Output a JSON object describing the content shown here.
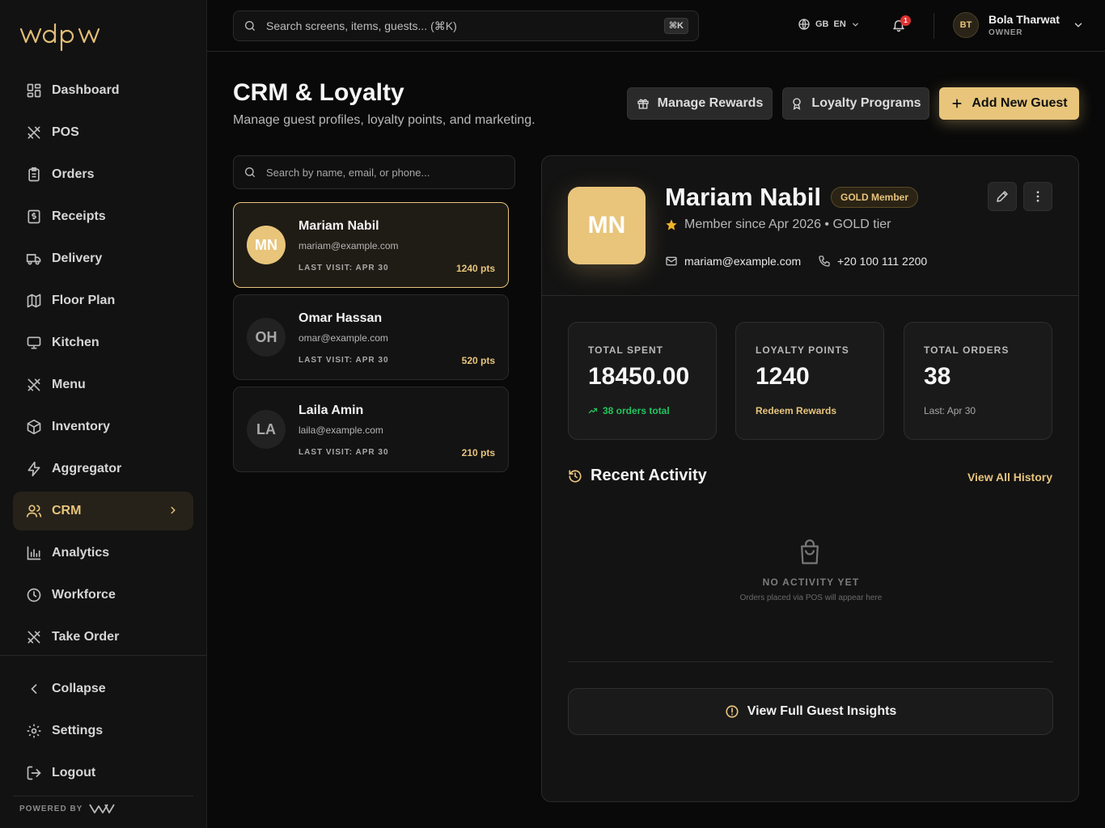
{
  "brand": {
    "logo_text": "wdpw",
    "powered_by": "POWERED BY"
  },
  "sidebar": {
    "items": [
      {
        "label": "Dashboard",
        "icon": "dashboard-icon"
      },
      {
        "label": "POS",
        "icon": "utensils-icon"
      },
      {
        "label": "Orders",
        "icon": "clipboard-icon"
      },
      {
        "label": "Receipts",
        "icon": "receipt-icon"
      },
      {
        "label": "Delivery",
        "icon": "truck-icon"
      },
      {
        "label": "Floor Plan",
        "icon": "map-icon"
      },
      {
        "label": "Kitchen",
        "icon": "monitor-icon"
      },
      {
        "label": "Menu",
        "icon": "utensils-icon"
      },
      {
        "label": "Inventory",
        "icon": "box-icon"
      },
      {
        "label": "Aggregator",
        "icon": "bolt-icon"
      },
      {
        "label": "CRM",
        "icon": "users-icon",
        "active": true
      },
      {
        "label": "Analytics",
        "icon": "bar-chart-icon"
      },
      {
        "label": "Workforce",
        "icon": "clock-icon"
      },
      {
        "label": "Take Order",
        "icon": "utensils-icon"
      }
    ],
    "bottom": {
      "collapse": "Collapse",
      "settings": "Settings",
      "logout": "Logout"
    }
  },
  "topbar": {
    "search_placeholder": "Search screens, items, guests... (⌘K)",
    "shortcut": "⌘K",
    "lang_flag": "GB",
    "lang_code": "EN",
    "notifications": "1",
    "user_initials": "BT",
    "user_name": "Bola Tharwat",
    "user_role": "OWNER"
  },
  "page": {
    "title": "CRM & Loyalty",
    "subtitle": "Manage guest profiles, loyalty points, and marketing.",
    "buttons": {
      "manage_rewards": "Manage Rewards",
      "loyalty_programs": "Loyalty Programs",
      "add_guest": "Add New Guest"
    }
  },
  "guests": {
    "search_placeholder": "Search by name, email, or phone...",
    "list": [
      {
        "initials": "MN",
        "name": "Mariam Nabil",
        "email": "mariam@example.com",
        "last_visit": "LAST VISIT: APR 30",
        "points": "1240 pts"
      },
      {
        "initials": "OH",
        "name": "Omar Hassan",
        "email": "omar@example.com",
        "last_visit": "LAST VISIT: APR 30",
        "points": "520 pts"
      },
      {
        "initials": "LA",
        "name": "Laila Amin",
        "email": "laila@example.com",
        "last_visit": "LAST VISIT: APR 30",
        "points": "210 pts"
      }
    ]
  },
  "detail": {
    "initials": "MN",
    "name": "Mariam Nabil",
    "badge": "GOLD Member",
    "since": "Member since Apr 2026 • GOLD tier",
    "email": "mariam@example.com",
    "phone": "+20 100 111 2200",
    "stats": {
      "spent_label": "TOTAL SPENT",
      "spent_value": "18450.00",
      "spent_foot": "38 orders total",
      "points_label": "LOYALTY POINTS",
      "points_value": "1240",
      "points_foot": "Redeem Rewards",
      "orders_label": "TOTAL ORDERS",
      "orders_value": "38",
      "orders_foot": "Last: Apr 30"
    },
    "activity": {
      "title": "Recent Activity",
      "view_all": "View All History",
      "empty_title": "NO ACTIVITY YET",
      "empty_sub": "Orders placed via POS will appear here"
    },
    "insights_button": "View Full Guest Insights"
  },
  "colors": {
    "accent": "#e8c57b",
    "background": "#090909",
    "panel": "#131313",
    "positive": "#22c55e",
    "badge_red": "#e03131"
  }
}
